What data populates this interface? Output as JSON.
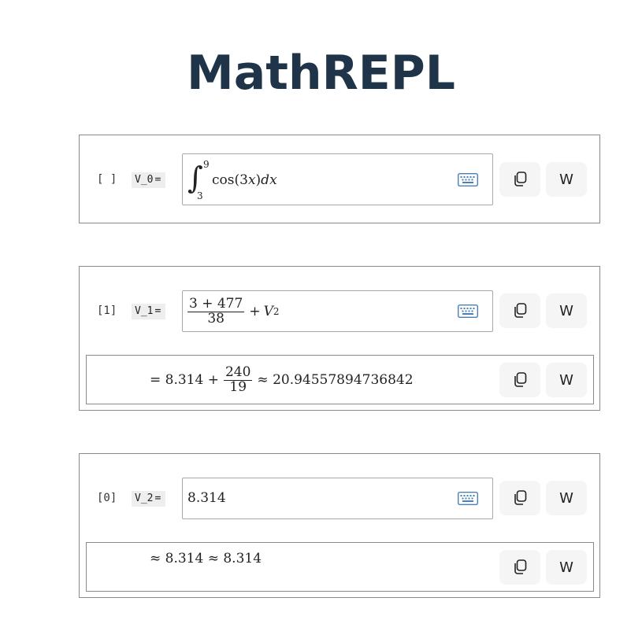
{
  "app": {
    "title": "MathREPL"
  },
  "cells": [
    {
      "index": "[ ]",
      "var_label": "V_0",
      "eq": "=",
      "input": {
        "lower": "3",
        "upper": "9",
        "integrand": "cos(3",
        "var": "x",
        "close": ")",
        "d": "d",
        "dvar": "x"
      },
      "keyboard_icon": "keyboard-icon",
      "copy_icon": "copy-icon",
      "w_label": "W"
    },
    {
      "index": "[1]",
      "var_label": "V_1",
      "eq": "=",
      "input": {
        "num": "3 + 477",
        "den": "38",
        "plus": "+",
        "v": "V",
        "sub": "2"
      },
      "output": {
        "prefix": "= 8.314 +",
        "num": "240",
        "den": "19",
        "approx": "≈ 20.94557894736842"
      },
      "keyboard_icon": "keyboard-icon",
      "copy_icon": "copy-icon",
      "w_label": "W"
    },
    {
      "index": "[0]",
      "var_label": "V_2",
      "eq": "=",
      "input": {
        "text": "8.314"
      },
      "output": {
        "text": "≈ 8.314 ≈ 8.314"
      },
      "keyboard_icon": "keyboard-icon",
      "copy_icon": "copy-icon",
      "w_label": "W"
    }
  ]
}
